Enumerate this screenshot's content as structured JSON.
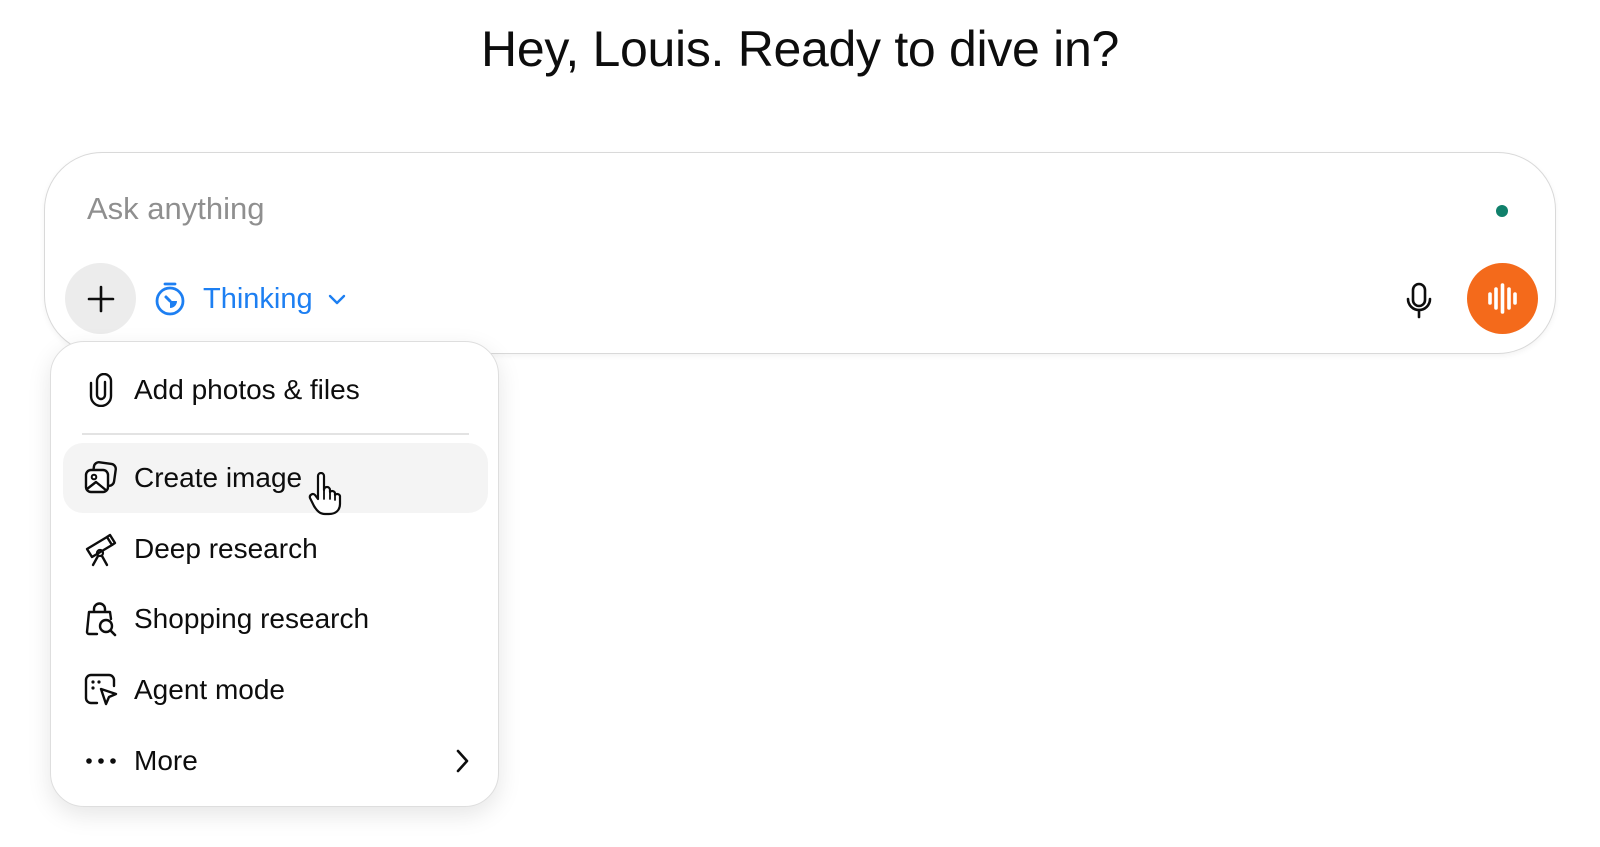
{
  "greeting": "Hey, Louis. Ready to dive in?",
  "composer": {
    "placeholder": "Ask anything",
    "value": "",
    "model_label": "Thinking",
    "status_color": "#10806b"
  },
  "menu": {
    "items": [
      {
        "label": "Add photos & files",
        "icon": "paperclip-icon"
      },
      {
        "label": "Create image",
        "icon": "create-image-icon",
        "hovered": true
      },
      {
        "label": "Deep research",
        "icon": "telescope-icon"
      },
      {
        "label": "Shopping research",
        "icon": "shopping-bag-search-icon"
      },
      {
        "label": "Agent mode",
        "icon": "agent-cursor-icon"
      },
      {
        "label": "More",
        "icon": "ellipsis-icon",
        "has_submenu": true
      }
    ]
  },
  "colors": {
    "accent_blue": "#1d7ff2",
    "voice_orange": "#f46a1b",
    "text": "#0d0d0d",
    "placeholder": "#8f8f8f"
  }
}
